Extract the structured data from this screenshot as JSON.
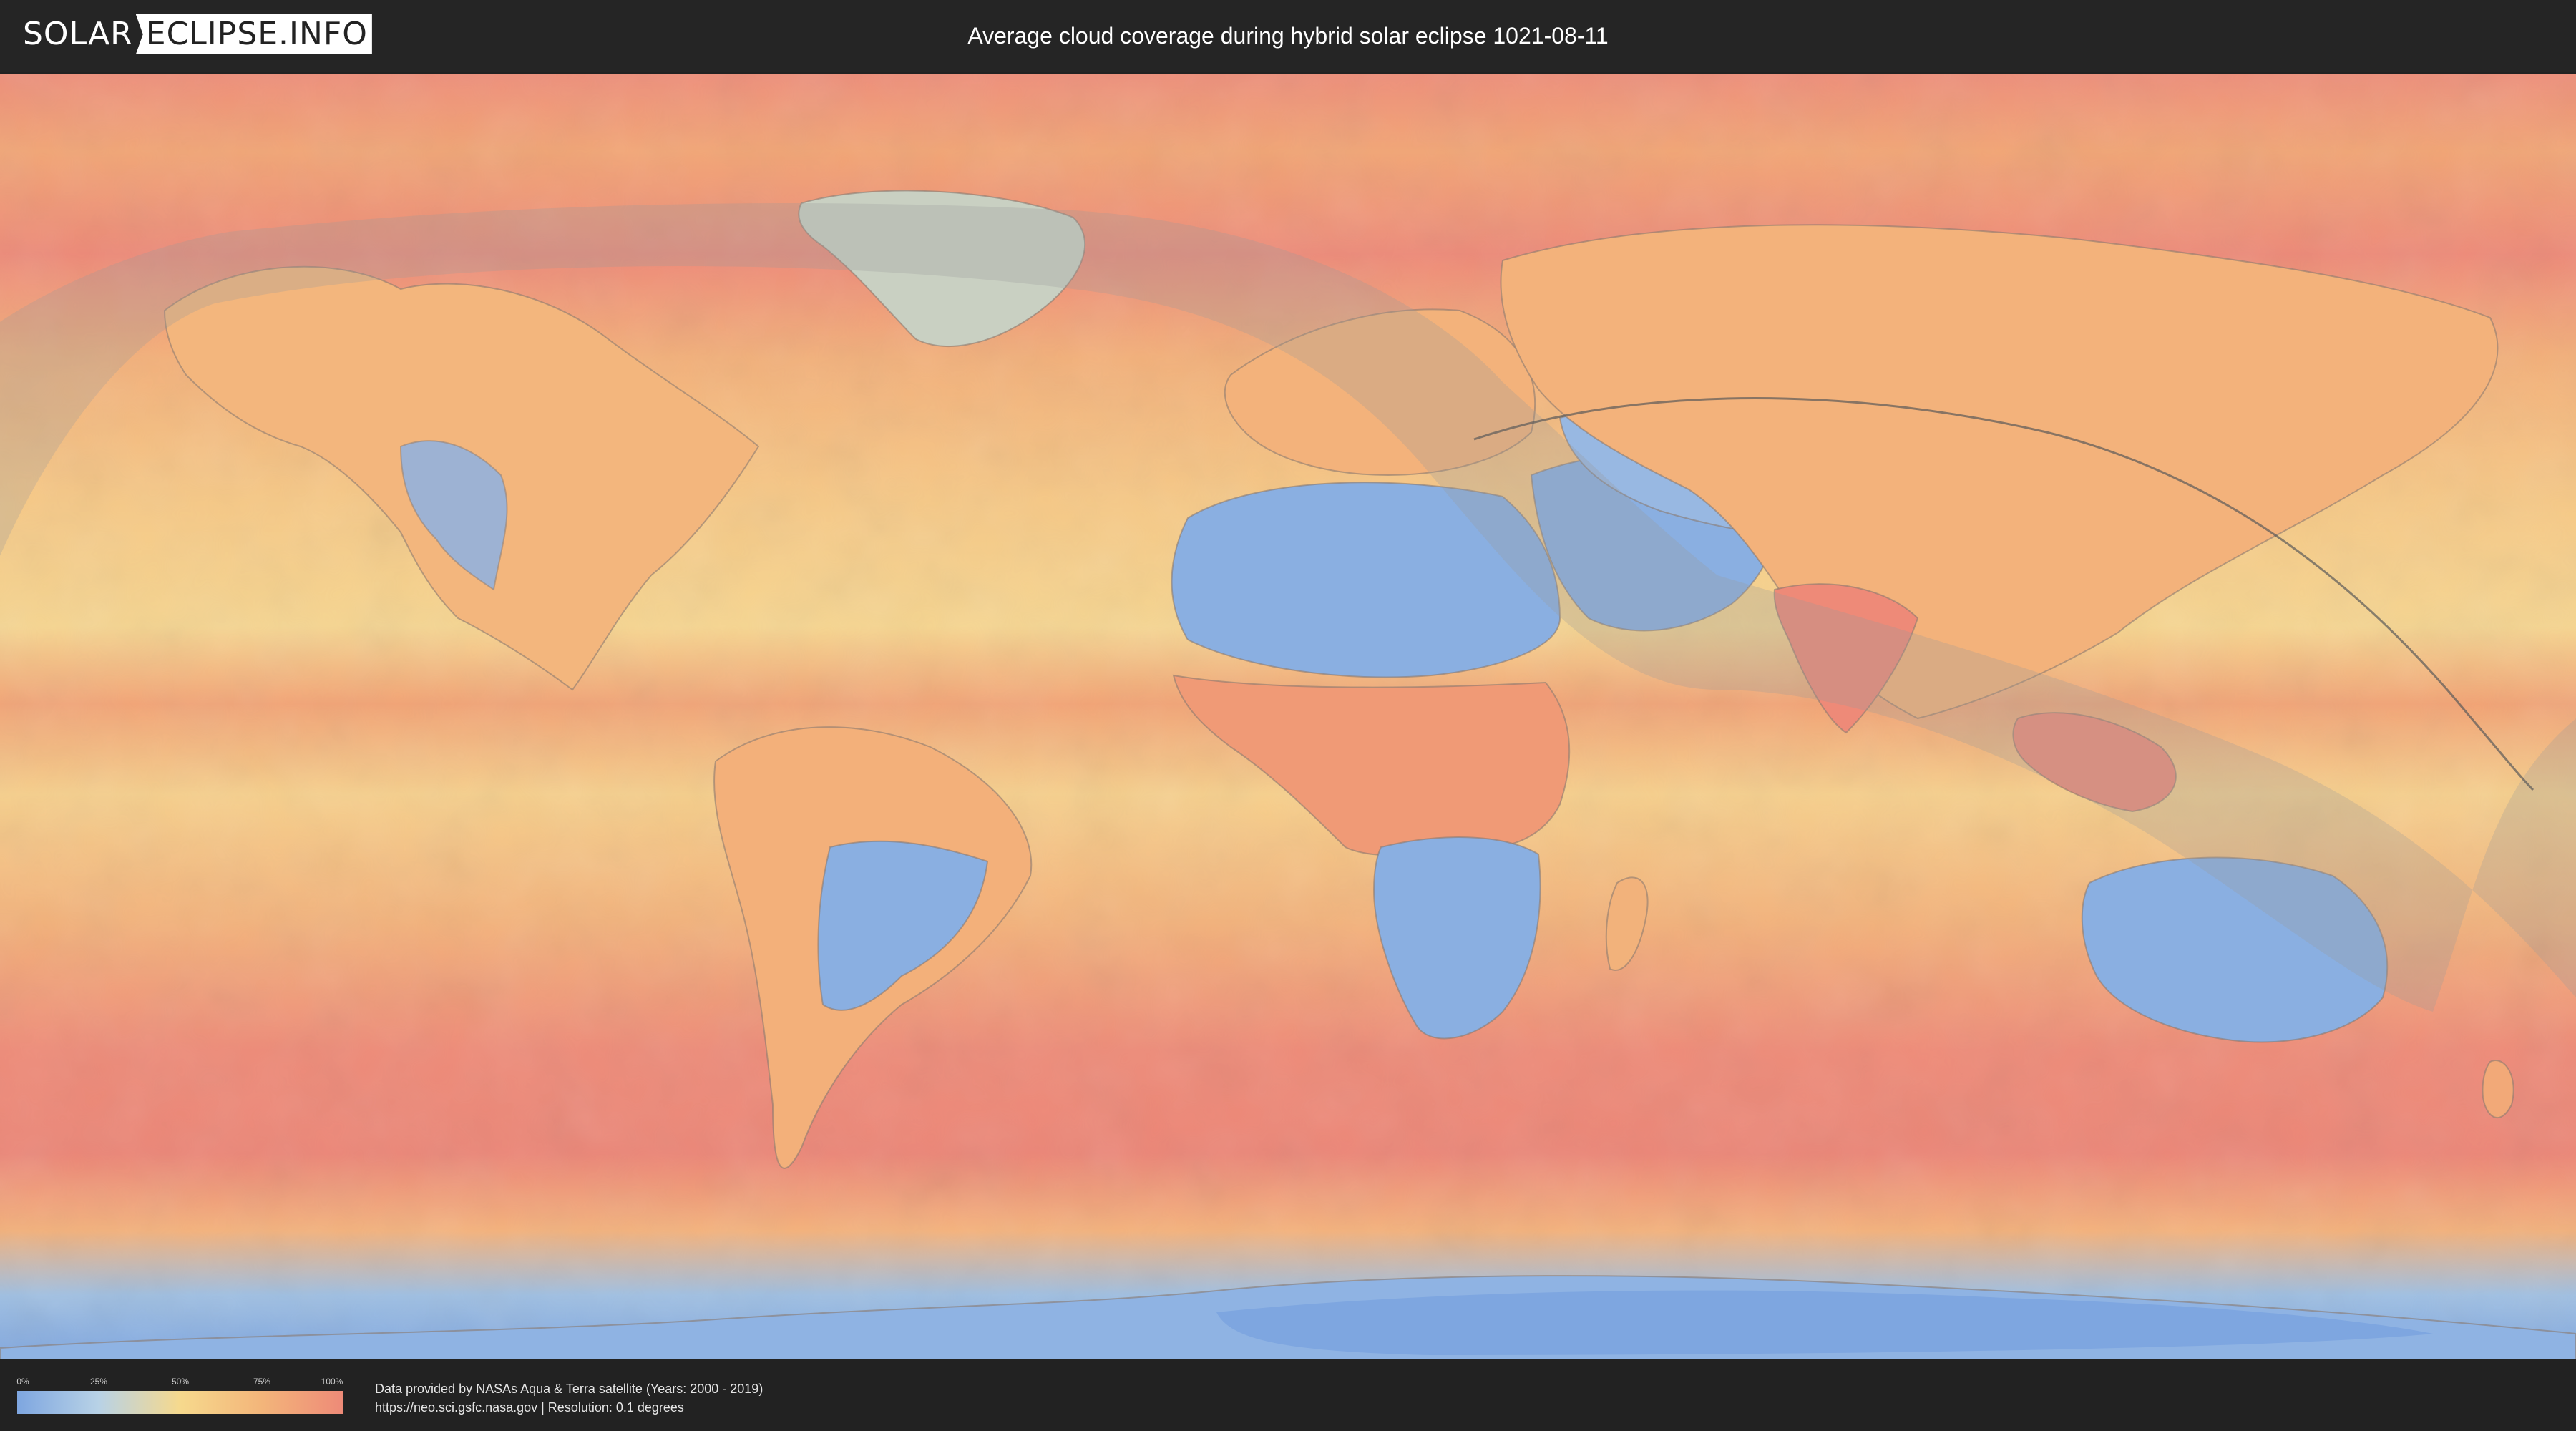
{
  "header": {
    "logo": {
      "left_text": "SOLAR",
      "right_text": "ECLIPSE.INFO"
    },
    "title": "Average cloud coverage during hybrid solar eclipse 1021-08-11"
  },
  "map": {
    "subject": "world cloud coverage map",
    "colors": {
      "clear": "#7ea6e0",
      "low": "#a9c6e4",
      "medium": "#f6d98d",
      "high": "#f3a46e",
      "overcast": "#ee8a78",
      "eclipse_shade": "#9a9a9a"
    }
  },
  "legend": {
    "ticks": [
      "0%",
      "25%",
      "50%",
      "75%",
      "100%"
    ],
    "tick_values": [
      0,
      0.25,
      0.5,
      0.75,
      1.0
    ],
    "colors": [
      "#7ea6e0",
      "#b8d2e6",
      "#f6d98d",
      "#f3b57a",
      "#ee8a78"
    ]
  },
  "footer": {
    "line1": "Data provided by NASAs Aqua & Terra satellite (Years: 2000 - 2019)",
    "line2": "https://neo.sci.gsfc.nasa.gov | Resolution: 0.1 degrees"
  }
}
